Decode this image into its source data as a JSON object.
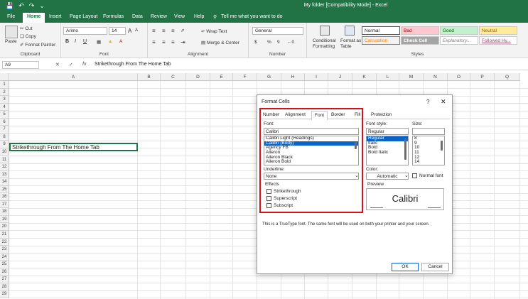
{
  "titlebar": {
    "title": "My folder  [Compatibility Mode]  -  Excel",
    "qat_save": "💾",
    "qat_undo": "↶",
    "qat_redo": "↷",
    "qat_more": "⌄"
  },
  "ribbon_tabs": {
    "file": "File",
    "home": "Home",
    "insert": "Insert",
    "page_layout": "Page Layout",
    "formulas": "Formulas",
    "data": "Data",
    "review": "Review",
    "view": "View",
    "help": "Help",
    "tell_me": "Tell me what you want to do"
  },
  "ribbon": {
    "clipboard": {
      "label": "Clipboard",
      "paste": "Paste",
      "cut": "Cut",
      "copy": "Copy",
      "format_painter": "Format Painter"
    },
    "font": {
      "label": "Font",
      "font_name": "Arimo",
      "font_size": "14",
      "bold": "B",
      "italic": "I",
      "underline": "U",
      "grow": "A",
      "shrink": "A"
    },
    "alignment": {
      "label": "Alignment",
      "wrap_text": "Wrap Text",
      "merge_center": "Merge & Center"
    },
    "number": {
      "label": "Number",
      "format": "General",
      "currency": "$",
      "percent": "%",
      "comma": "9"
    },
    "styles": {
      "label": "Styles",
      "conditional": "Conditional",
      "conditional2": "Formatting",
      "format_as": "Format as",
      "format_as2": "Table",
      "normal": "Normal",
      "bad": "Bad",
      "good": "Good",
      "neutral": "Neutral",
      "calculation": "Calculation",
      "check_cell": "Check Cell",
      "explanatory": "Explanatory...",
      "followed": "Followed Hy..."
    }
  },
  "formula_bar": {
    "name_box": "A9",
    "cancel": "✕",
    "enter": "✓",
    "fx": "fx",
    "content": "Strikethrough From The Home Tab"
  },
  "sheet": {
    "columns": [
      "A",
      "B",
      "C",
      "D",
      "E",
      "F",
      "G",
      "H",
      "I",
      "J",
      "K",
      "L",
      "M",
      "N",
      "O",
      "P",
      "Q"
    ],
    "rows": [
      "1",
      "2",
      "3",
      "4",
      "5",
      "6",
      "7",
      "8",
      "9",
      "10",
      "11",
      "12",
      "13",
      "14",
      "15",
      "16",
      "17",
      "18",
      "19",
      "20",
      "21",
      "22",
      "23",
      "24",
      "25",
      "26",
      "27",
      "28",
      "29"
    ],
    "active_cell_text": "Strikethrough From The Home Tab"
  },
  "dialog": {
    "title": "Format Cells",
    "help": "?",
    "close": "✕",
    "tabs": [
      "Number",
      "Alignment",
      "Font",
      "Border",
      "Fill",
      "Protection"
    ],
    "font_label": "Font:",
    "font_value": "Calibri",
    "font_list": [
      "Calibri Light (Headings)",
      "Calibri (Body)",
      "Agency FB",
      "Aileron",
      "Aileron Black",
      "Aileron Bold"
    ],
    "style_label": "Font style:",
    "style_value": "Regular",
    "style_list": [
      "Regular",
      "Italic",
      "Bold",
      "Bold Italic"
    ],
    "size_label": "Size:",
    "size_value": "",
    "size_list": [
      "8",
      "9",
      "10",
      "11",
      "12",
      "14"
    ],
    "underline_label": "Underline:",
    "underline_value": "None",
    "color_label": "Color:",
    "color_value": "Automatic",
    "normal_font": "Normal font",
    "effects_label": "Effects",
    "strikethrough": "Strikethrough",
    "superscript": "Superscript",
    "subscript": "Subscript",
    "preview_label": "Preview",
    "preview_text": "Calibri",
    "info": "This is a TrueType font.  The same font will be used on both your printer and your screen.",
    "ok": "OK",
    "cancel": "Cancel"
  },
  "colors": {
    "excel_green": "#217346",
    "highlight_red": "#d3121d",
    "selection_blue": "#0a63c9"
  }
}
